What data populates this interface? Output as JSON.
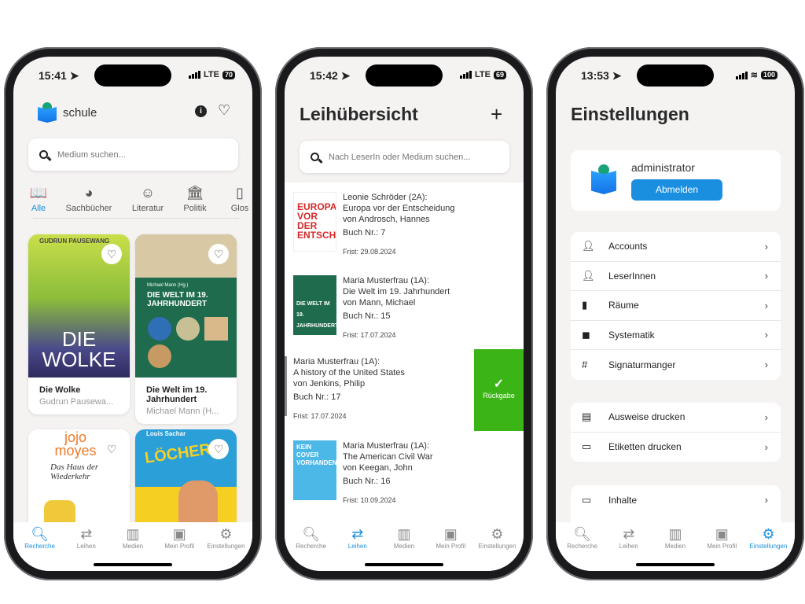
{
  "accent": "#1a8fe0",
  "success": "#3bb515",
  "tabs": [
    "Recherche",
    "Leihen",
    "Medien",
    "Mein Profil",
    "Einstellungen"
  ],
  "tab_icons": [
    "search-icon",
    "swap-icon",
    "book-icon",
    "profile-icon",
    "gear-icon"
  ],
  "phone1": {
    "status": {
      "time": "15:41",
      "network": "LTE",
      "battery": "70"
    },
    "brand": "schule",
    "search_placeholder": "Medium suchen...",
    "categories": [
      {
        "label": "Alle",
        "icon": "book-open-icon"
      },
      {
        "label": "Sachbücher",
        "icon": "pie-chart-icon"
      },
      {
        "label": "Literatur",
        "icon": "theater-masks-icon"
      },
      {
        "label": "Politik",
        "icon": "landmark-icon"
      },
      {
        "label": "Glos",
        "icon": "glossary-icon"
      }
    ],
    "books": [
      {
        "title": "Die Wolke",
        "author": "Gudrun Pausewa...",
        "cover_text": "DIE WOLKE",
        "cover_author": "GUDRUN PAUSEWANG"
      },
      {
        "title": "Die Welt im 19. Jahrhundert",
        "author": "Michael Mann (H...",
        "cover_text": "DIE WELT IM 19. JAHRHUNDERT",
        "cover_author": "Michael Mann (Hg.)"
      },
      {
        "cover_text": "Das Haus der Wiederkehr",
        "cover_author": "jojo moyes"
      },
      {
        "cover_text": "LÖCHER",
        "cover_author": "Louis Sachar"
      }
    ],
    "active_tab": 0
  },
  "phone2": {
    "status": {
      "time": "15:42",
      "network": "LTE",
      "battery": "69"
    },
    "title": "Leihübersicht",
    "add_icon": "plus-icon",
    "search_placeholder": "Nach LeserIn oder Medium suchen...",
    "loans": [
      {
        "reader": "Leonie Schröder (2A):",
        "title": "Europa vor der Entscheidung",
        "author": "von Androsch, Hannes",
        "number": "Buch Nr.: 7",
        "due": "Frist: 29.08.2024",
        "cover_text": "EUROPA VOR DER ENTSCHEIDUNG"
      },
      {
        "reader": "Maria Musterfrau (1A):",
        "title": "Die Welt im 19. Jahrhundert",
        "author": "von Mann, Michael",
        "number": "Buch Nr.: 15",
        "due": "Frist: 17.07.2024",
        "cover_text": "DIE WELT IM 19. JAHRHUNDERT"
      },
      {
        "reader": "Maria Musterfrau (1A):",
        "title": "A history of the United States",
        "author": "von Jenkins, Philip",
        "number": "Buch Nr.: 17",
        "due": "Frist: 17.07.2024"
      },
      {
        "reader": "Maria Musterfrau (1A):",
        "title": "The American Civil War",
        "author": "von Keegan, John",
        "number": "Buch Nr.: 16",
        "due": "Frist: 10.09.2024",
        "cover_text": "KEIN COVER VORHANDEN"
      }
    ],
    "return_action": "Rückgabe",
    "active_tab": 1
  },
  "phone3": {
    "status": {
      "time": "13:53",
      "battery": "100"
    },
    "title": "Einstellungen",
    "user": "administrator",
    "logout": "Abmelden",
    "group1": [
      {
        "label": "Accounts",
        "icon": "person-icon"
      },
      {
        "label": "LeserInnen",
        "icon": "person-search-icon"
      },
      {
        "label": "Räume",
        "icon": "door-icon"
      },
      {
        "label": "Systematik",
        "icon": "label-icon"
      },
      {
        "label": "Signaturmanger",
        "icon": "hashtag-icon"
      }
    ],
    "group2": [
      {
        "label": "Ausweise drucken",
        "icon": "id-badge-icon"
      },
      {
        "label": "Etiketten drucken",
        "icon": "tag-outline-icon"
      }
    ],
    "group3": [
      {
        "label": "Inhalte",
        "icon": "monitor-icon"
      }
    ],
    "active_tab": 4
  }
}
